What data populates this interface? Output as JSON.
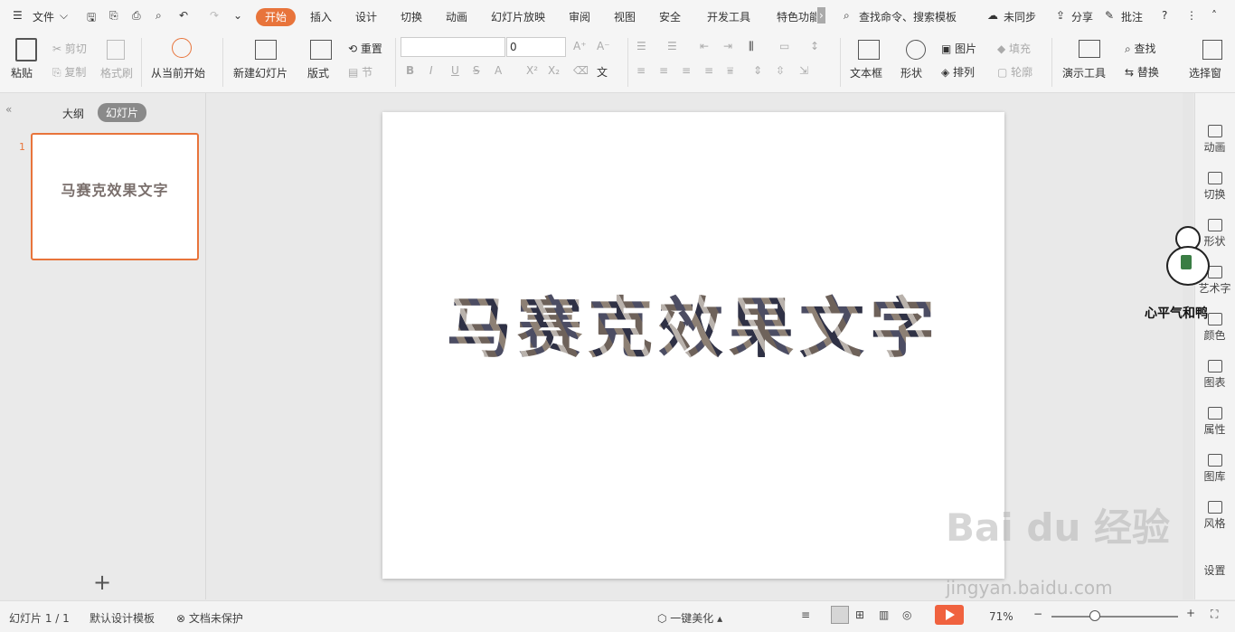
{
  "menu": {
    "file": "文件",
    "tabs": [
      "开始",
      "插入",
      "设计",
      "切换",
      "动画",
      "幻灯片放映",
      "审阅",
      "视图",
      "安全",
      "开发工具",
      "特色功能"
    ],
    "search": "查找命令、搜索模板",
    "sync": "未同步",
    "share": "分享",
    "comment": "批注",
    "help": "?"
  },
  "ribbon": {
    "paste": "粘贴",
    "cut": "剪切",
    "copy": "复制",
    "format_painter": "格式刷",
    "from_current": "从当前开始",
    "new_slide": "新建幻灯片",
    "layout": "版式",
    "reset": "重置",
    "section": "节",
    "font_size": "0",
    "text_box": "文本框",
    "shape": "形状",
    "picture": "图片",
    "fill": "填充",
    "arrange": "排列",
    "outline": "轮廓",
    "present_tools": "演示工具",
    "find": "查找",
    "replace": "替换",
    "select_pane": "选择窗"
  },
  "panel": {
    "outline_tab": "大纲",
    "slides_tab": "幻灯片",
    "slide_number": "1",
    "thumb_text": "马赛克效果文字",
    "add": "+"
  },
  "slide": {
    "title": "马赛克效果文字"
  },
  "sidebar": {
    "items": [
      "动画",
      "切换",
      "形状",
      "艺术字",
      "颜色",
      "图表",
      "属性",
      "图库",
      "风格",
      "设置"
    ]
  },
  "status": {
    "slide_count": "幻灯片 1 / 1",
    "template": "默认设计模板",
    "protect": "文档未保护",
    "beautify": "一键美化",
    "zoom": "71%"
  },
  "watermark": {
    "brand": "Bai du 经验",
    "url": "jingyan.baidu.com",
    "duck_caption": "心平气和鸭"
  }
}
